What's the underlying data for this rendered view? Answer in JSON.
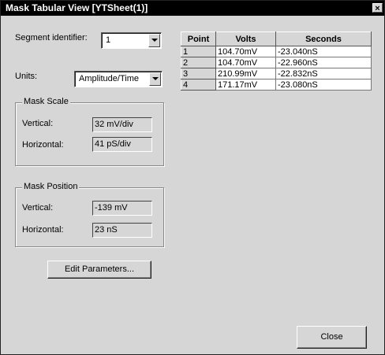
{
  "window": {
    "title": "Mask Tabular View [YTSheet(1)]",
    "close_glyph": "×"
  },
  "segment": {
    "label": "Segment identifier:",
    "value": "1"
  },
  "units": {
    "label": "Units:",
    "value": "Amplitude/Time"
  },
  "mask_scale": {
    "title": "Mask Scale",
    "vertical_label": "Vertical:",
    "vertical_value": "32 mV/div",
    "horizontal_label": "Horizontal:",
    "horizontal_value": "41 pS/div"
  },
  "mask_position": {
    "title": "Mask Position",
    "vertical_label": "Vertical:",
    "vertical_value": "-139 mV",
    "horizontal_label": "Horizontal:",
    "horizontal_value": "23 nS"
  },
  "buttons": {
    "edit_parameters": "Edit Parameters...",
    "close": "Close"
  },
  "table": {
    "headers": [
      "Point",
      "Volts",
      "Seconds"
    ],
    "rows": [
      {
        "point": "1",
        "volts": "104.70mV",
        "seconds": "-23.040nS"
      },
      {
        "point": "2",
        "volts": "104.70mV",
        "seconds": "-22.960nS"
      },
      {
        "point": "3",
        "volts": "210.99mV",
        "seconds": "-22.832nS"
      },
      {
        "point": "4",
        "volts": "171.17mV",
        "seconds": "-23.080nS"
      }
    ]
  },
  "icons": {
    "dropdown": "chevron-down-icon",
    "close": "close-icon"
  }
}
